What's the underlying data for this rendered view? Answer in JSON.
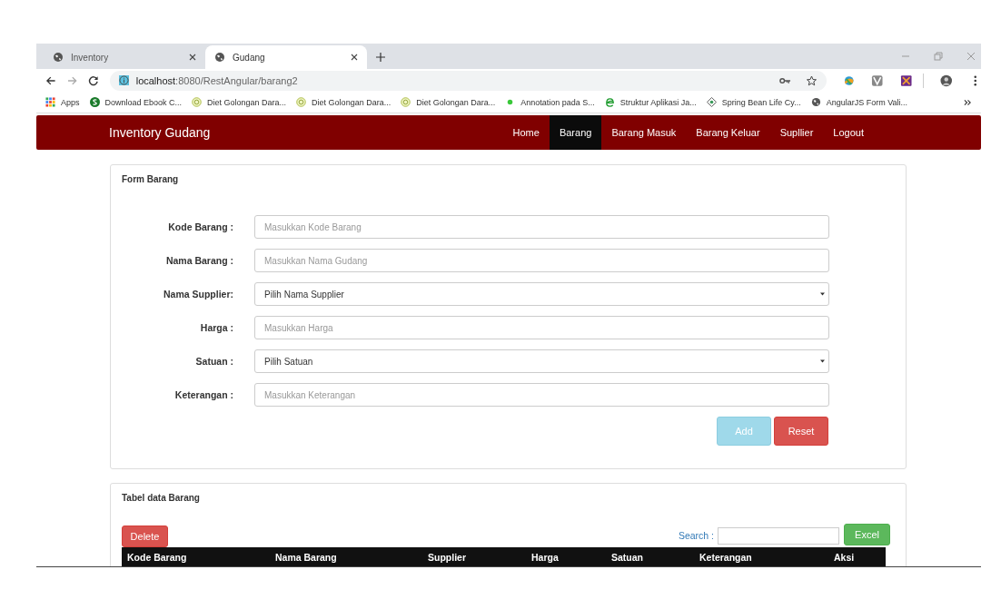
{
  "browser": {
    "tabs": [
      {
        "title": "Inventory",
        "selected": false
      },
      {
        "title": "Gudang",
        "selected": true
      }
    ],
    "address_host": "localhost",
    "address_path": ":8080/RestAngular/barang2",
    "bookmarks": [
      {
        "label": "Apps",
        "kind": "apps"
      },
      {
        "label": "Download Ebook C...",
        "kind": "s"
      },
      {
        "label": "Diet Golongan Dara...",
        "kind": "diet"
      },
      {
        "label": "Diet Golongan Dara...",
        "kind": "diet"
      },
      {
        "label": "Diet Golongan Dara...",
        "kind": "diet"
      },
      {
        "label": "Annotation pada S...",
        "kind": "dot"
      },
      {
        "label": "Struktur Aplikasi Ja...",
        "kind": "e"
      },
      {
        "label": "Spring Bean Life Cy...",
        "kind": "diamond"
      },
      {
        "label": "AngularJS Form Vali...",
        "kind": "globe"
      }
    ]
  },
  "navbar": {
    "brand": "Inventory Gudang",
    "items": [
      {
        "label": "Home",
        "selected": false
      },
      {
        "label": "Barang",
        "selected": true
      },
      {
        "label": "Barang Masuk",
        "selected": false
      },
      {
        "label": "Barang Keluar",
        "selected": false
      },
      {
        "label": "Supllier",
        "selected": false
      },
      {
        "label": "Logout",
        "selected": false
      }
    ]
  },
  "form": {
    "title": "Form Barang",
    "fields": [
      {
        "label": "Kode Barang :",
        "kind": "input",
        "placeholder": "Masukkan Kode Barang"
      },
      {
        "label": "Nama Barang :",
        "kind": "input",
        "placeholder": "Masukkan Nama Gudang"
      },
      {
        "label": "Nama Supplier:",
        "kind": "select",
        "value": "Pilih Nama Supplier"
      },
      {
        "label": "Harga :",
        "kind": "input",
        "placeholder": "Masukkan Harga"
      },
      {
        "label": "Satuan :",
        "kind": "select",
        "value": "Pilih Satuan"
      },
      {
        "label": "Keterangan :",
        "kind": "input",
        "placeholder": "Masukkan Keterangan"
      }
    ],
    "add_button": {
      "label": "Add",
      "disabled": true
    },
    "reset_button": {
      "label": "Reset"
    }
  },
  "table": {
    "title": "Tabel data Barang",
    "delete_button": "Delete",
    "search_label": "Search :",
    "excel_button": "Excel",
    "columns": [
      "Kode Barang",
      "Nama Barang",
      "Supplier",
      "Harga",
      "Satuan",
      "Keterangan",
      "Aksi"
    ]
  }
}
